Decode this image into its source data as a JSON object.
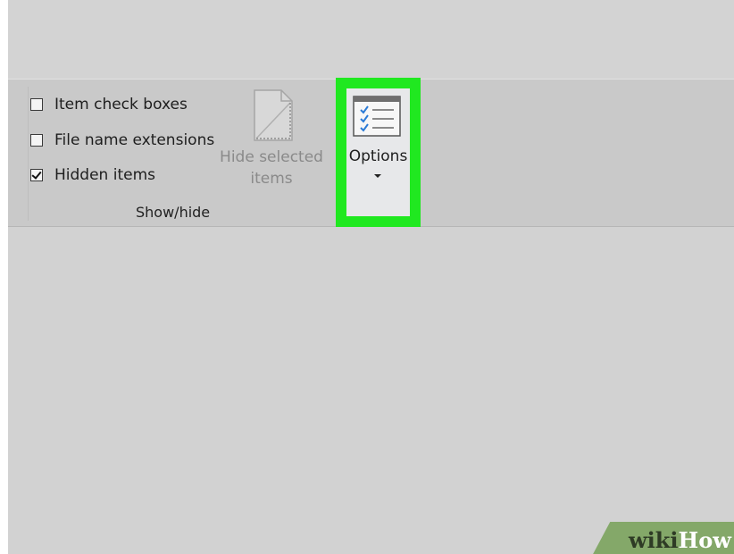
{
  "ribbon": {
    "show_hide": {
      "items": [
        {
          "label": "Item check boxes",
          "checked": false
        },
        {
          "label": "File name extensions",
          "checked": false
        },
        {
          "label": "Hidden items",
          "checked": true
        }
      ],
      "group_label": "Show/hide"
    },
    "hide_selected": {
      "label_line1": "Hide selected",
      "label_line2": "items",
      "icon": "document-hide-icon",
      "enabled": false
    },
    "options": {
      "label": "Options",
      "icon": "options-checklist-icon",
      "highlight_color": "#20e820"
    }
  },
  "watermark": {
    "part1": "wiki",
    "part2": "How"
  }
}
